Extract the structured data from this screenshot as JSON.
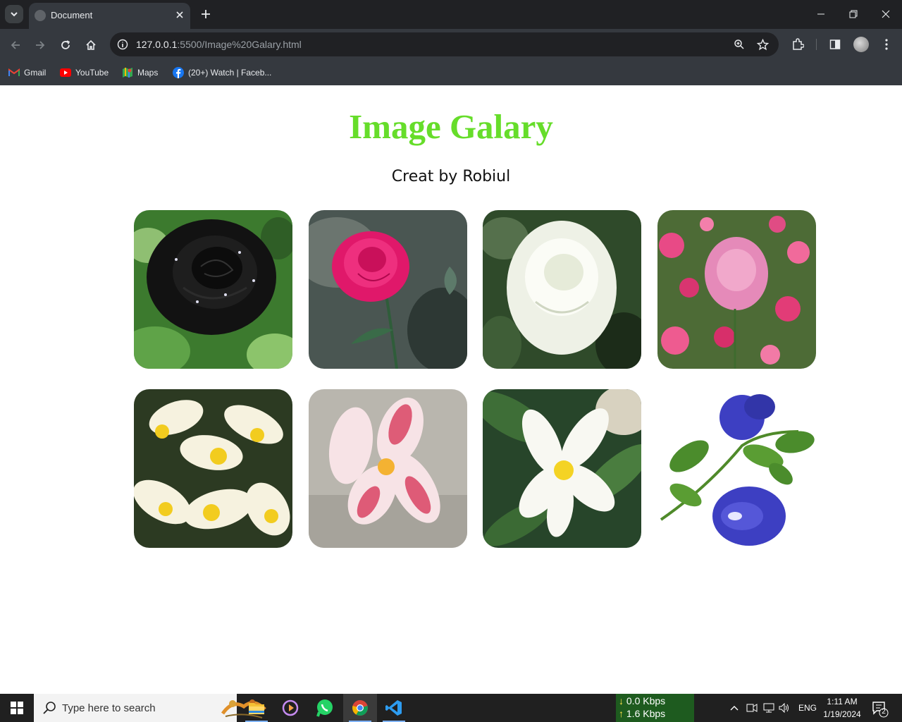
{
  "browser": {
    "tab": {
      "title": "Document"
    },
    "url": {
      "host": "127.0.0.1",
      "rest": ":5500/Image%20Galary.html"
    },
    "bookmarks": [
      {
        "label": "Gmail",
        "icon": "gmail-icon"
      },
      {
        "label": "YouTube",
        "icon": "youtube-icon"
      },
      {
        "label": "Maps",
        "icon": "maps-icon"
      },
      {
        "label": "(20+) Watch | Faceb...",
        "icon": "facebook-icon"
      }
    ]
  },
  "page": {
    "title": "Image Galary",
    "subtitle": "Creat by Robiul",
    "title_color": "#66dd2a",
    "images": [
      {
        "subject": "black-rose"
      },
      {
        "subject": "pink-rose"
      },
      {
        "subject": "white-rose"
      },
      {
        "subject": "pink-roses-bush"
      },
      {
        "subject": "yellow-white-plumeria"
      },
      {
        "subject": "pink-plumeria"
      },
      {
        "subject": "white-plumeria"
      },
      {
        "subject": "blue-butterfly-pea"
      }
    ]
  },
  "taskbar": {
    "search_placeholder": "Type here to search",
    "net_down": "0.0 Kbps",
    "net_up": "1.6 Kbps",
    "language": "ENG",
    "time": "1:11 AM",
    "date": "1/19/2024",
    "notification_count": "2"
  }
}
